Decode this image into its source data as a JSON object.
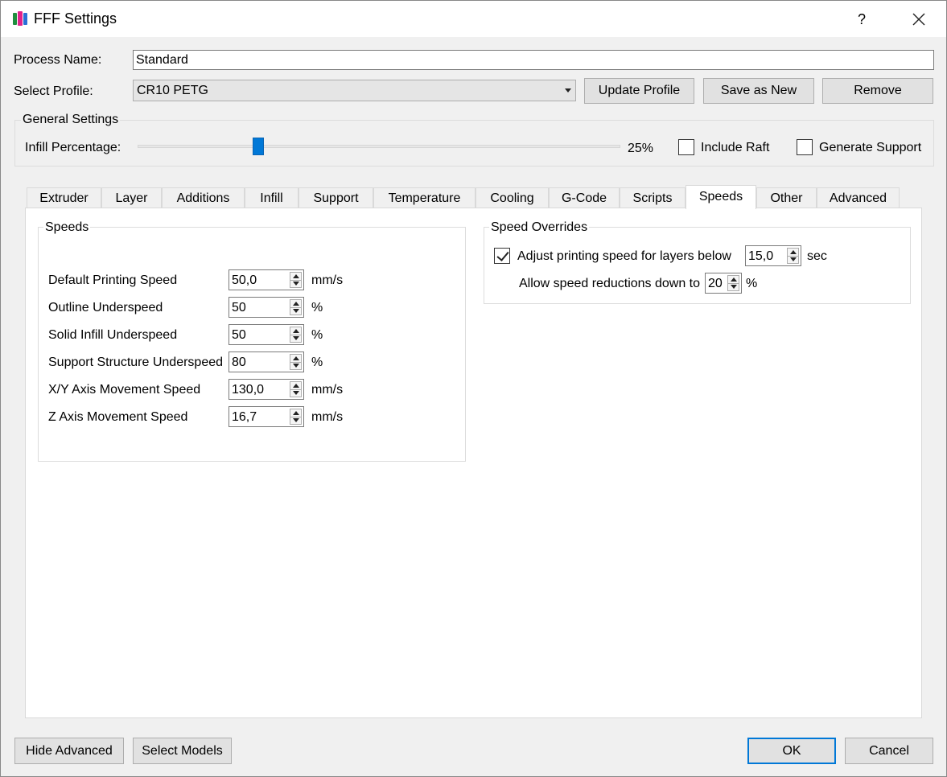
{
  "window": {
    "title": "FFF Settings",
    "help_label": "?",
    "close_icon": "close-icon",
    "app_icon": "fff-settings-app-icon"
  },
  "process": {
    "name_label": "Process Name:",
    "name_value": "Standard"
  },
  "profile": {
    "select_label": "Select Profile:",
    "selected": "CR10 PETG",
    "update_button": "Update Profile",
    "save_new_button": "Save as New",
    "remove_button": "Remove"
  },
  "general": {
    "title": "General Settings",
    "infill_label": "Infill Percentage:",
    "infill_value_text": "25%",
    "infill_fraction": 0.25,
    "raft_label": "Include Raft",
    "raft_checked": false,
    "support_label": "Generate Support",
    "support_checked": false
  },
  "tabs": [
    {
      "label": "Extruder"
    },
    {
      "label": "Layer"
    },
    {
      "label": "Additions"
    },
    {
      "label": "Infill"
    },
    {
      "label": "Support"
    },
    {
      "label": "Temperature"
    },
    {
      "label": "Cooling"
    },
    {
      "label": "G-Code"
    },
    {
      "label": "Scripts"
    },
    {
      "label": "Speeds"
    },
    {
      "label": "Other"
    },
    {
      "label": "Advanced"
    }
  ],
  "active_tab": "Speeds",
  "speeds": {
    "title": "Speeds",
    "rows": [
      {
        "label": "Default Printing Speed",
        "value": "50,0",
        "unit": "mm/s"
      },
      {
        "label": "Outline Underspeed",
        "value": "50",
        "unit": "%"
      },
      {
        "label": "Solid Infill Underspeed",
        "value": "50",
        "unit": "%"
      },
      {
        "label": "Support Structure Underspeed",
        "value": "80",
        "unit": "%"
      },
      {
        "label": "X/Y Axis Movement Speed",
        "value": "130,0",
        "unit": "mm/s"
      },
      {
        "label": "Z Axis Movement Speed",
        "value": "16,7",
        "unit": "mm/s"
      }
    ]
  },
  "overrides": {
    "title": "Speed Overrides",
    "adjust_label": "Adjust printing speed for layers below",
    "adjust_checked": true,
    "adjust_value": "15,0",
    "adjust_unit": "sec",
    "reduce_label": "Allow speed reductions down to",
    "reduce_value": "20",
    "reduce_unit": "%"
  },
  "footer": {
    "hide_advanced": "Hide Advanced",
    "select_models": "Select Models",
    "ok": "OK",
    "cancel": "Cancel"
  }
}
